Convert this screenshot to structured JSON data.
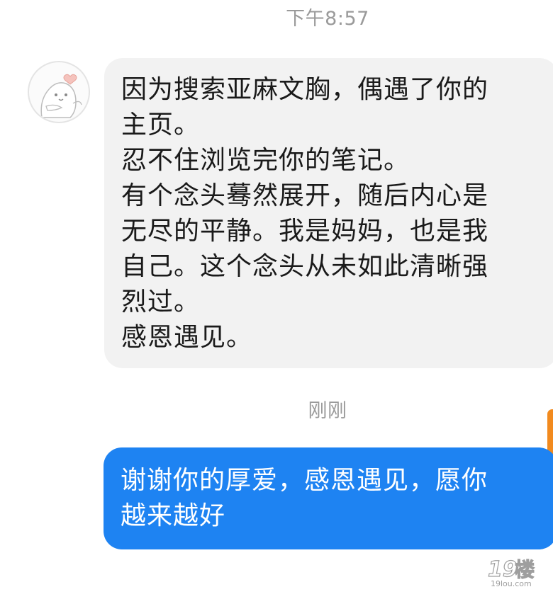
{
  "chat": {
    "timestamp_top": "下午8:57",
    "timestamp_recent": "刚刚",
    "incoming": {
      "text": "因为搜索亚麻文胸，偶遇了你的\n主页。\n忍不住浏览完你的笔记。\n有个念头蓦然展开，随后内心是\n无尽的平静。我是妈妈，也是我\n自己。这个念头从未如此清晰强\n烈过。\n感恩遇见。"
    },
    "outgoing": {
      "text": "谢谢你的厚爱，感恩遇见，愿你\n越来越好"
    }
  },
  "watermark": {
    "brand": "19楼",
    "domain": "19lou.com"
  },
  "colors": {
    "incoming_bubble": "#f2f2f2",
    "outgoing_bubble": "#1e83f2",
    "timestamp": "#9a9a9a",
    "accent": "#f28a1e"
  },
  "icons": {
    "avatar": "cartoon-character-avatar"
  }
}
